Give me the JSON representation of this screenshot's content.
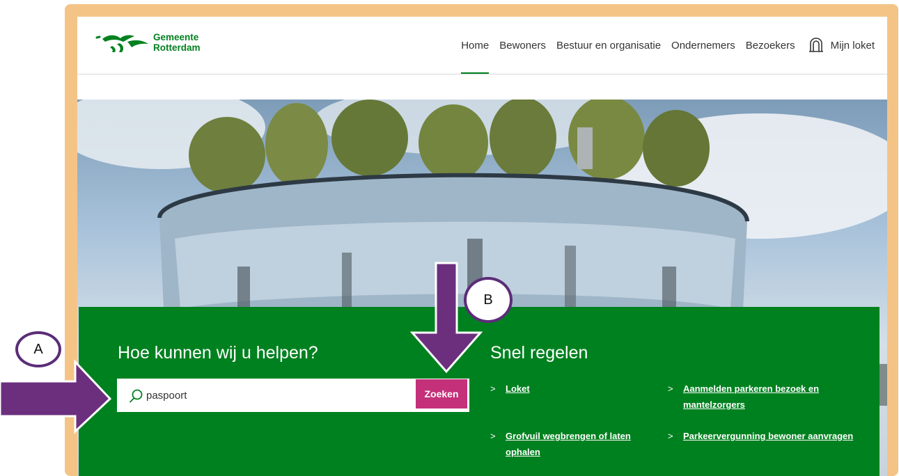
{
  "header": {
    "logo_line1": "Gemeente",
    "logo_line2": "Rotterdam",
    "nav": [
      "Home",
      "Bewoners",
      "Bestuur en organisatie",
      "Ondernemers",
      "Bezoekers"
    ],
    "active_nav": "Home",
    "account_label": "Mijn loket"
  },
  "help": {
    "title": "Hoe kunnen wij u helpen?",
    "search_value": "paspoort",
    "search_button": "Zoeken"
  },
  "quick": {
    "title": "Snel regelen",
    "links": [
      "Loket",
      "Aanmelden parkeren bezoek en mantelzorgers",
      "Grofvuil wegbrengen of laten ophalen",
      "Parkeervergunning bewoner aanvragen"
    ]
  },
  "annotations": {
    "a": "A",
    "b": "B"
  },
  "colors": {
    "brand_green": "#00811f",
    "search_button": "#c4317a",
    "annotation_purple": "#5b2d78",
    "frame_orange": "#f4c487"
  },
  "icons": [
    "rotterdam-logo-icon",
    "account-icon",
    "search-icon",
    "chevron-right-icon"
  ]
}
